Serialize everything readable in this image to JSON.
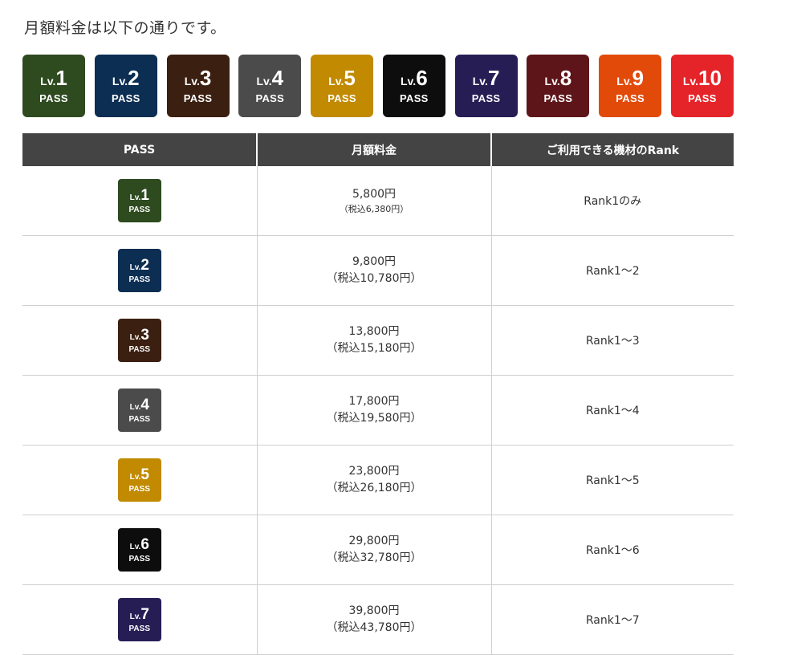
{
  "intro_text": "月額料金は以下の通りです。",
  "badges": [
    {
      "lv": "Lv.",
      "num": "1",
      "pass": "PASS",
      "color": "#2e4a1f"
    },
    {
      "lv": "Lv.",
      "num": "2",
      "pass": "PASS",
      "color": "#0c2e52"
    },
    {
      "lv": "Lv.",
      "num": "3",
      "pass": "PASS",
      "color": "#3b1f10"
    },
    {
      "lv": "Lv.",
      "num": "4",
      "pass": "PASS",
      "color": "#4b4b4b"
    },
    {
      "lv": "Lv.",
      "num": "5",
      "pass": "PASS",
      "color": "#c18a00"
    },
    {
      "lv": "Lv.",
      "num": "6",
      "pass": "PASS",
      "color": "#0d0d0d"
    },
    {
      "lv": "Lv.",
      "num": "7",
      "pass": "PASS",
      "color": "#271d55"
    },
    {
      "lv": "Lv.",
      "num": "8",
      "pass": "PASS",
      "color": "#5e1519"
    },
    {
      "lv": "Lv.",
      "num": "9",
      "pass": "PASS",
      "color": "#e24a0a"
    },
    {
      "lv": "Lv.",
      "num": "10",
      "pass": "PASS",
      "color": "#e5242a"
    }
  ],
  "table": {
    "headers": [
      "PASS",
      "月額料金",
      "ご利用できる機材のRank"
    ],
    "rows": [
      {
        "lv": "Lv.",
        "num": "1",
        "pass": "PASS",
        "color": "#2e4a1f",
        "price": "5,800円",
        "price_tax": "（税込6,380円）",
        "rank": "Rank1のみ"
      },
      {
        "lv": "Lv.",
        "num": "2",
        "pass": "PASS",
        "color": "#0c2e52",
        "price": "9,800円",
        "price_tax": "（税込10,780円）",
        "rank": "Rank1～2"
      },
      {
        "lv": "Lv.",
        "num": "3",
        "pass": "PASS",
        "color": "#3b1f10",
        "price": "13,800円",
        "price_tax": "（税込15,180円）",
        "rank": "Rank1～3"
      },
      {
        "lv": "Lv.",
        "num": "4",
        "pass": "PASS",
        "color": "#4b4b4b",
        "price": "17,800円",
        "price_tax": "（税込19,580円）",
        "rank": "Rank1～4"
      },
      {
        "lv": "Lv.",
        "num": "5",
        "pass": "PASS",
        "color": "#c18a00",
        "price": "23,800円",
        "price_tax": "（税込26,180円）",
        "rank": "Rank1～5"
      },
      {
        "lv": "Lv.",
        "num": "6",
        "pass": "PASS",
        "color": "#0d0d0d",
        "price": "29,800円",
        "price_tax": "（税込32,780円）",
        "rank": "Rank1～6"
      },
      {
        "lv": "Lv.",
        "num": "7",
        "pass": "PASS",
        "color": "#271d55",
        "price": "39,800円",
        "price_tax": "（税込43,780円）",
        "rank": "Rank1～7"
      }
    ]
  }
}
